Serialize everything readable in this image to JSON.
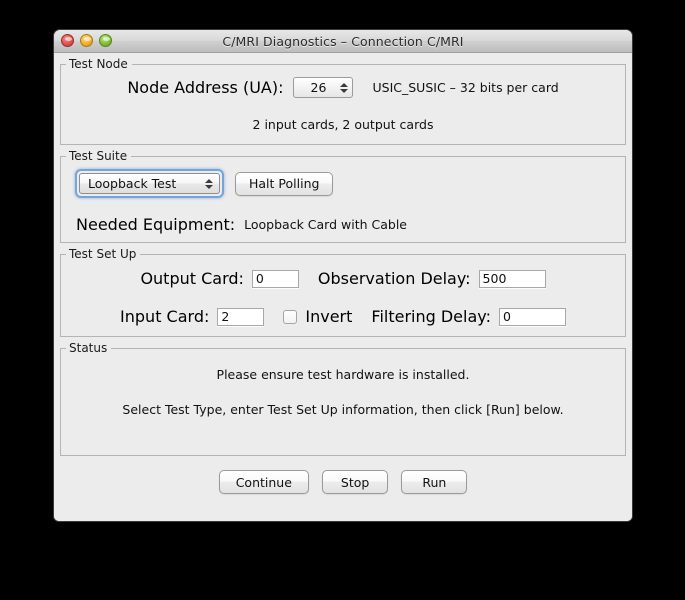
{
  "window": {
    "title": "C/MRI Diagnostics – Connection C/MRI",
    "traffic_lights": [
      "close-button",
      "minimize-button",
      "zoom-button"
    ],
    "colors": {
      "close": "#e0605c",
      "minimize": "#f5b93c",
      "zoom": "#8cc63f",
      "focus_ring": "#6096d7",
      "window_bg": "#ececec"
    }
  },
  "test_node": {
    "legend": "Test Node",
    "node_address_label": "Node Address (UA):",
    "node_address_value": "26",
    "card_info": "USIC_SUSIC – 32 bits per card",
    "card_counts": "2 input cards, 2 output cards"
  },
  "test_suite": {
    "legend": "Test Suite",
    "selected_test": "Loopback Test",
    "halt_polling_label": "Halt Polling",
    "needed_equipment_label": "Needed Equipment:",
    "needed_equipment_value": "Loopback Card with Cable"
  },
  "test_setup": {
    "legend": "Test Set Up",
    "output_card_label": "Output Card:",
    "output_card_value": "0",
    "observation_delay_label": "Observation Delay:",
    "observation_delay_value": "500",
    "input_card_label": "Input Card:",
    "input_card_value": "2",
    "invert_label": "Invert",
    "invert_checked": false,
    "filtering_delay_label": "Filtering Delay:",
    "filtering_delay_value": "0"
  },
  "status": {
    "legend": "Status",
    "line1": "Please ensure test hardware is installed.",
    "line2": "Select Test Type, enter Test Set Up information, then click [Run] below."
  },
  "footer": {
    "continue_label": "Continue",
    "stop_label": "Stop",
    "run_label": "Run"
  }
}
